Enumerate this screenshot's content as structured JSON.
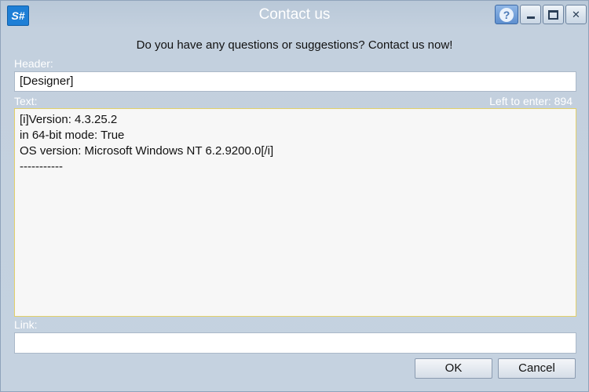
{
  "window": {
    "title": "Contact us",
    "logo_text": "S#",
    "help_glyph": "?",
    "close_glyph": "✕"
  },
  "prompt": "Do you have any questions or suggestions? Contact us now!",
  "header": {
    "label": "Header:",
    "value": "[Designer]"
  },
  "text": {
    "label": "Text:",
    "left_to_enter": "Left to enter: 894",
    "lines": [
      "[i]Version: 4.3.25.2",
      "in 64-bit mode: True",
      "OS version: Microsoft Windows NT 6.2.9200.0[/i]",
      "-----------"
    ]
  },
  "link": {
    "label": "Link:",
    "value": ""
  },
  "buttons": {
    "ok": "OK",
    "cancel": "Cancel"
  }
}
